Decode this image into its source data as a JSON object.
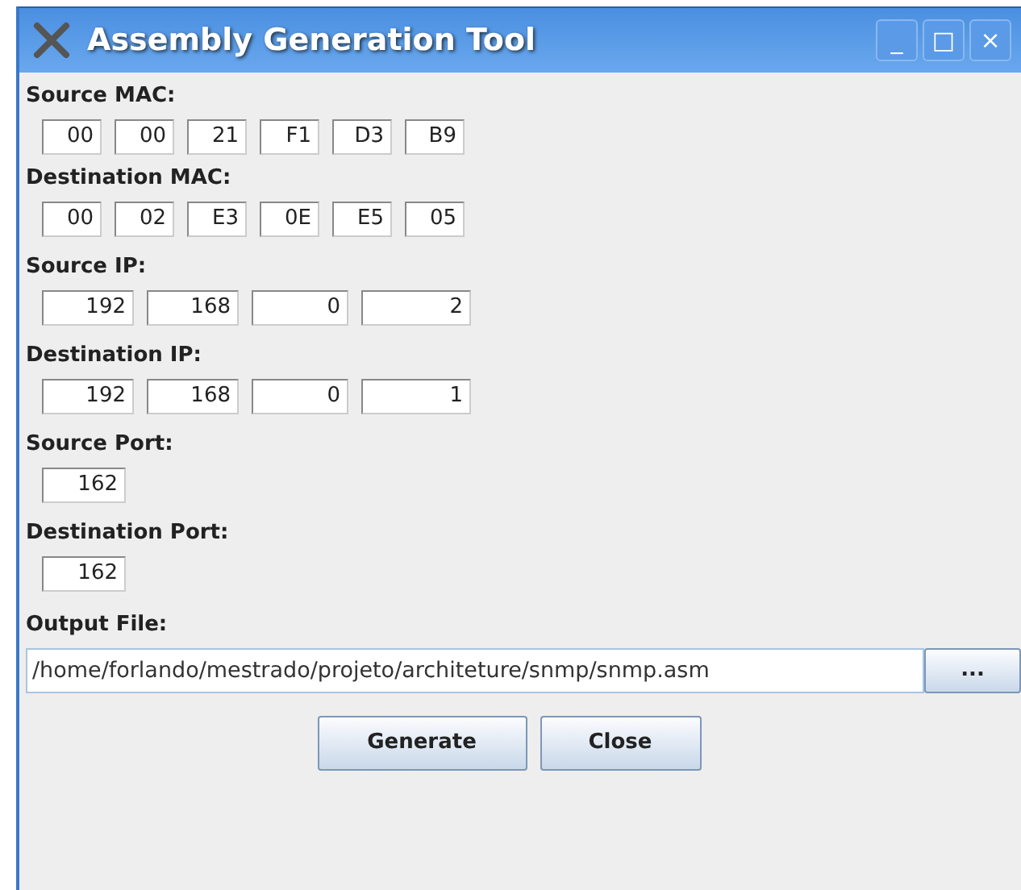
{
  "window": {
    "title": "Assembly Generation Tool",
    "controls": [
      "_",
      "□",
      "×"
    ]
  },
  "sections": [
    {
      "label": "Source MAC:",
      "fields": [
        {
          "value": "00"
        },
        {
          "value": "00"
        },
        {
          "value": "21"
        },
        {
          "value": "F1"
        },
        {
          "value": "D3"
        },
        {
          "value": "B9"
        }
      ]
    },
    {
      "label": "Destination MAC:",
      "fields": [
        {
          "value": "00"
        },
        {
          "value": "02"
        },
        {
          "value": "E3"
        },
        {
          "value": "0E"
        },
        {
          "value": "E5"
        },
        {
          "value": "05"
        }
      ]
    },
    {
      "label": "Source IP:",
      "fields": [
        {
          "value": "192"
        },
        {
          "value": "168"
        },
        {
          "value": "0"
        },
        {
          "value": "2"
        }
      ]
    },
    {
      "label": "Destination IP:",
      "fields": [
        {
          "value": "192"
        },
        {
          "value": "168"
        },
        {
          "value": "0"
        },
        {
          "value": "1"
        }
      ]
    },
    {
      "label": "Source Port:",
      "fields": [
        {
          "value": "162"
        }
      ]
    },
    {
      "label": "Destination Port:",
      "fields": [
        {
          "value": "162"
        }
      ]
    }
  ],
  "output_file": {
    "label": "Output File:",
    "value": "/home/forlando/mestrado/projeto/architeture/snmp/snmp.asm",
    "browse": "..."
  },
  "buttons": [
    "Generate",
    "Close"
  ]
}
